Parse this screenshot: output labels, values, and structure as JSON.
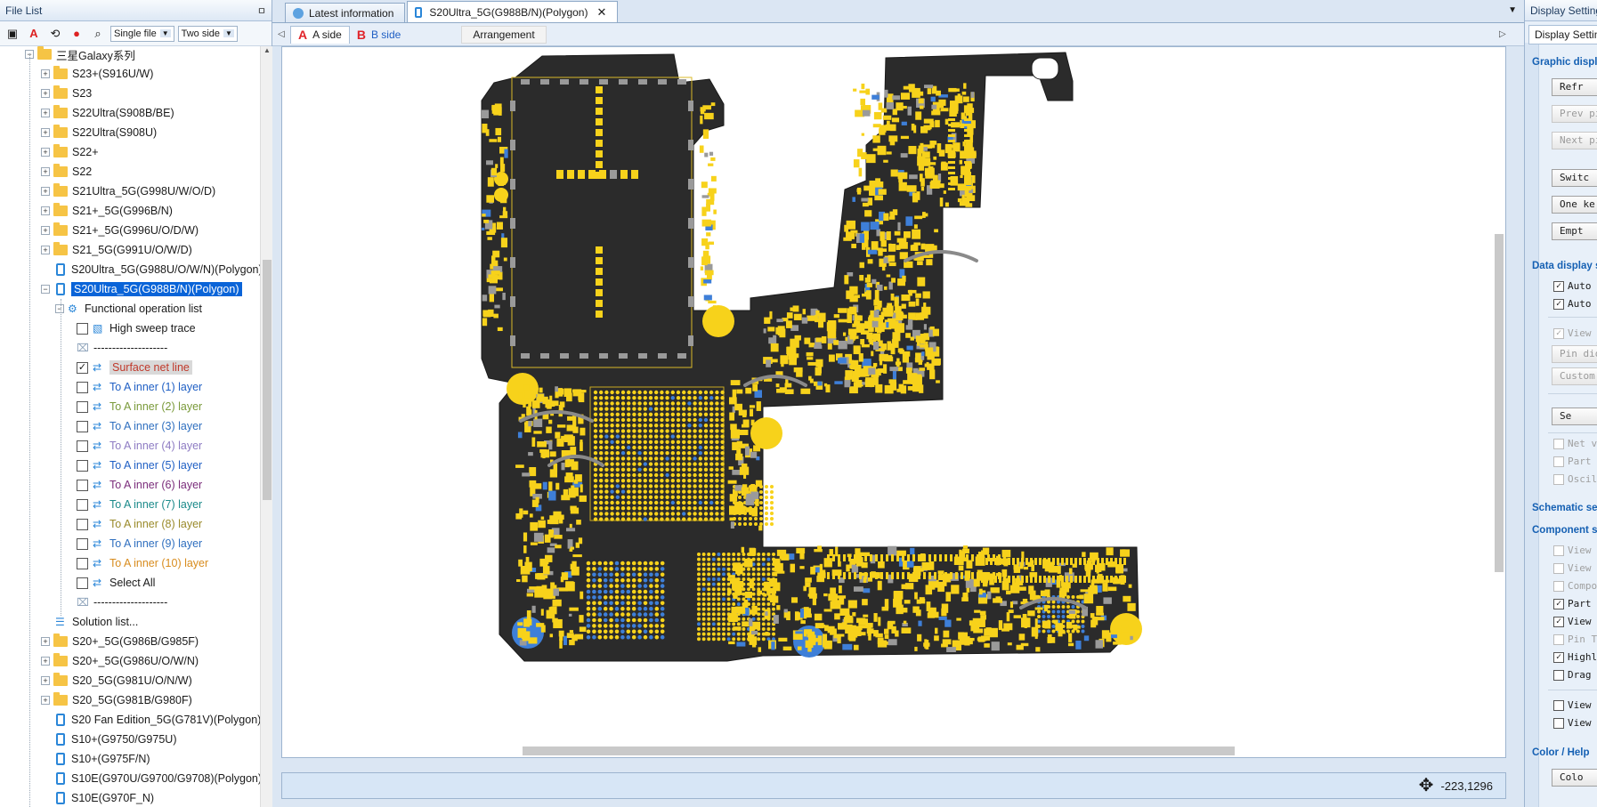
{
  "left_panel": {
    "title": "File List",
    "pin": "ㅁ",
    "toolbar": {
      "mode_select": "Single file",
      "side_select": "Two side"
    },
    "tree": [
      {
        "label": "三星Galaxy系列",
        "type": "folder",
        "level": 1,
        "expander": "−"
      },
      {
        "label": "S23+(S916U/W)",
        "type": "folder",
        "level": 2,
        "expander": "+"
      },
      {
        "label": "S23",
        "type": "folder",
        "level": 2,
        "expander": "+"
      },
      {
        "label": "S22Ultra(S908B/BE)",
        "type": "folder",
        "level": 2,
        "expander": "+"
      },
      {
        "label": "S22Ultra(S908U)",
        "type": "folder",
        "level": 2,
        "expander": "+"
      },
      {
        "label": "S22+",
        "type": "folder",
        "level": 2,
        "expander": "+"
      },
      {
        "label": "S22",
        "type": "folder",
        "level": 2,
        "expander": "+"
      },
      {
        "label": "S21Ultra_5G(G998U/W/O/D)",
        "type": "folder",
        "level": 2,
        "expander": "+"
      },
      {
        "label": "S21+_5G(G996B/N)",
        "type": "folder",
        "level": 2,
        "expander": "+"
      },
      {
        "label": "S21+_5G(G996U/O/D/W)",
        "type": "folder",
        "level": 2,
        "expander": "+"
      },
      {
        "label": "S21_5G(G991U/O/W/D)",
        "type": "folder",
        "level": 2,
        "expander": "+"
      },
      {
        "label": "S20Ultra_5G(G988U/O/W/N)(Polygon)",
        "type": "phone",
        "level": 2,
        "expander": ""
      },
      {
        "label": "S20Ultra_5G(G988B/N)(Polygon)",
        "type": "phone",
        "level": 2,
        "expander": "−",
        "selected": true
      },
      {
        "label": "Functional operation list",
        "type": "gear",
        "level": 3,
        "expander": "−"
      },
      {
        "label": "High sweep trace",
        "type": "check",
        "level": 4,
        "checked": false,
        "color": "#1a1a1a",
        "icon": "image"
      },
      {
        "label": "--------------------",
        "type": "sep",
        "level": 4
      },
      {
        "label": "Surface net line",
        "type": "check",
        "level": 4,
        "checked": true,
        "color": "#c0392b",
        "highlight": true
      },
      {
        "label": "To A inner (1) layer",
        "type": "check",
        "level": 4,
        "checked": false,
        "color": "#1f5fc4"
      },
      {
        "label": "To A inner (2) layer",
        "type": "check",
        "level": 4,
        "checked": false,
        "color": "#7a9a3a"
      },
      {
        "label": "To A inner (3) layer",
        "type": "check",
        "level": 4,
        "checked": false,
        "color": "#2f6fbf"
      },
      {
        "label": "To A inner (4) layer",
        "type": "check",
        "level": 4,
        "checked": false,
        "color": "#8e7cc3"
      },
      {
        "label": "To A inner (5) layer",
        "type": "check",
        "level": 4,
        "checked": false,
        "color": "#1f5fc4"
      },
      {
        "label": "To A inner (6) layer",
        "type": "check",
        "level": 4,
        "checked": false,
        "color": "#7b2d7b"
      },
      {
        "label": "To A inner (7) layer",
        "type": "check",
        "level": 4,
        "checked": false,
        "color": "#1b8a8a"
      },
      {
        "label": "To A inner (8) layer",
        "type": "check",
        "level": 4,
        "checked": false,
        "color": "#9a8a2a"
      },
      {
        "label": "To A inner (9) layer",
        "type": "check",
        "level": 4,
        "checked": false,
        "color": "#2f6fbf"
      },
      {
        "label": "To A inner (10) layer",
        "type": "check",
        "level": 4,
        "checked": false,
        "color": "#d88c1e"
      },
      {
        "label": "Select All",
        "type": "check",
        "level": 4,
        "checked": false,
        "color": "#1a1a1a"
      },
      {
        "label": "--------------------",
        "type": "sep",
        "level": 4
      },
      {
        "label": "Solution list...",
        "type": "list",
        "level": 3
      },
      {
        "label": "S20+_5G(G986B/G985F)",
        "type": "folder",
        "level": 2,
        "expander": "+"
      },
      {
        "label": "S20+_5G(G986U/O/W/N)",
        "type": "folder",
        "level": 2,
        "expander": "+"
      },
      {
        "label": "S20_5G(G981U/O/N/W)",
        "type": "folder",
        "level": 2,
        "expander": "+"
      },
      {
        "label": "S20_5G(G981B/G980F)",
        "type": "folder",
        "level": 2,
        "expander": "+"
      },
      {
        "label": "S20 Fan Edition_5G(G781V)(Polygon)",
        "type": "phone",
        "level": 2,
        "expander": ""
      },
      {
        "label": "S10+(G9750/G975U)",
        "type": "phone",
        "level": 2,
        "expander": ""
      },
      {
        "label": "S10+(G975F/N)",
        "type": "phone",
        "level": 2,
        "expander": ""
      },
      {
        "label": "S10E(G970U/G9700/G9708)(Polygon)",
        "type": "phone",
        "level": 2,
        "expander": ""
      },
      {
        "label": "S10E(G970F_N)",
        "type": "phone",
        "level": 2,
        "expander": ""
      }
    ]
  },
  "center": {
    "tabs": [
      {
        "label": "Latest information",
        "active": false
      },
      {
        "label": "S20Ultra_5G(G988B/N)(Polygon)",
        "active": true,
        "close": "✕"
      }
    ],
    "tab_menu": "▼",
    "sides": [
      {
        "letter": "A",
        "label": "A side",
        "active": true
      },
      {
        "letter": "B",
        "label": "B side",
        "active": false
      }
    ],
    "arrangement": "Arrangement",
    "nav_left": "◁",
    "nav_right": "▷",
    "coordinates": "-223,1296"
  },
  "right_panel": {
    "title": "Display Settings",
    "tab": "Display Settings",
    "sections": {
      "graphic": "Graphic display",
      "data": "Data display s",
      "schematic": "Schematic set",
      "component": "Component s",
      "color": "Color / Help"
    },
    "buttons": [
      {
        "label": "Refr",
        "disabled": false
      },
      {
        "label": "Prev pi",
        "disabled": true
      },
      {
        "label": "Next pi",
        "disabled": true
      },
      {
        "label": "Switc",
        "disabled": false
      },
      {
        "label": "One ke",
        "disabled": false
      },
      {
        "label": "Empt",
        "disabled": false
      },
      {
        "label": "Pin diod",
        "disabled": true
      },
      {
        "label": "Custom",
        "disabled": true
      },
      {
        "label": "Se",
        "disabled": false
      },
      {
        "label": "Colo",
        "disabled": false
      }
    ],
    "checks": [
      {
        "label": "Auto v",
        "checked": true,
        "disabled": false
      },
      {
        "label": "Auto v",
        "checked": true,
        "disabled": false
      },
      {
        "label": "View p",
        "checked": true,
        "disabled": true
      },
      {
        "label": "Net vo",
        "checked": false,
        "disabled": true
      },
      {
        "label": "Part n",
        "checked": false,
        "disabled": true
      },
      {
        "label": "Oscill",
        "checked": false,
        "disabled": true
      },
      {
        "label": "View P",
        "checked": false,
        "disabled": true
      },
      {
        "label": "View P",
        "checked": false,
        "disabled": true
      },
      {
        "label": "Compon",
        "checked": false,
        "disabled": true
      },
      {
        "label": "Part f",
        "checked": true,
        "disabled": false
      },
      {
        "label": "View a",
        "checked": true,
        "disabled": false
      },
      {
        "label": "Pin To",
        "checked": false,
        "disabled": true
      },
      {
        "label": "Highli",
        "checked": true,
        "disabled": false
      },
      {
        "label": "Drag n",
        "checked": false,
        "disabled": false
      },
      {
        "label": "View C",
        "checked": false,
        "disabled": false
      },
      {
        "label": "View b",
        "checked": false,
        "disabled": false
      }
    ]
  },
  "colors": {
    "board": "#2b2b2b",
    "pad": "#f7d21b",
    "pad_blue": "#3e7fd8",
    "selection": "#0a64d8"
  }
}
